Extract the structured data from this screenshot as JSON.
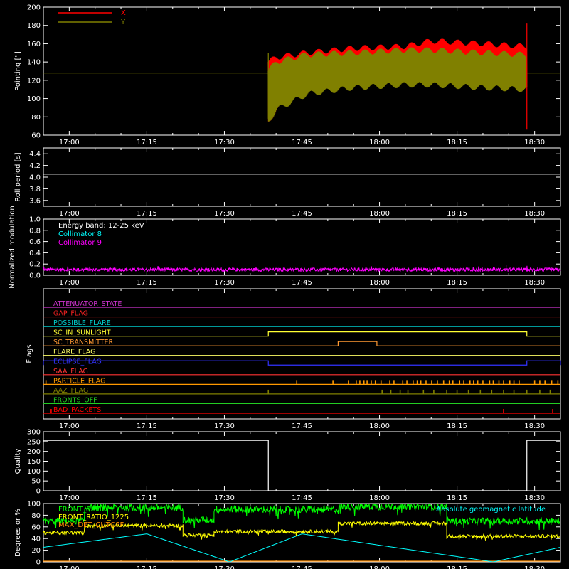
{
  "time_axis": {
    "range_minutes": [
      1015,
      1115
    ],
    "tick_minutes": [
      1020,
      1035,
      1050,
      1065,
      1080,
      1095,
      1110
    ],
    "tick_labels": [
      "17:00",
      "17:15",
      "17:30",
      "17:45",
      "18:00",
      "18:15",
      "18:30"
    ]
  },
  "chart_data": [
    {
      "id": "pointing",
      "type": "line",
      "ylabel": "Pointing [\"]",
      "ylim": [
        60,
        200
      ],
      "yticks": [
        60,
        80,
        100,
        120,
        140,
        160,
        180,
        200
      ],
      "grid": false,
      "legend_position": "top-left",
      "series": [
        {
          "name": "X",
          "color": "#ff0000",
          "baseline": 128,
          "active_range": [
            1058.5,
            1108.5
          ],
          "envelope": {
            "x": [
              1058.5,
              1060,
              1066,
              1075,
              1085,
              1090,
              1100,
              1108
            ],
            "upper": [
              140,
              145,
              150,
              155,
              157,
              163,
              160,
              157
            ],
            "lower": [
              75,
              88,
              108,
              116,
              117,
              117,
              115,
              114
            ]
          }
        },
        {
          "name": "Y",
          "color": "#808000",
          "baseline": 128,
          "active_range": [
            1058.5,
            1108.5
          ],
          "envelope": {
            "x": [
              1058.5,
              1060,
              1066,
              1075,
              1085,
              1090,
              1100,
              1108
            ],
            "upper": [
              130,
              140,
              148,
              150,
              153,
              153,
              150,
              148
            ],
            "lower": [
              75,
              88,
              105,
              112,
              115,
              115,
              112,
              110
            ]
          }
        }
      ]
    },
    {
      "id": "roll_period",
      "type": "line",
      "ylabel": "Roll period [s]",
      "ylim": [
        3.5,
        4.5
      ],
      "yticks": [
        3.6,
        3.8,
        4.0,
        4.2,
        4.4
      ],
      "ytick_labels": [
        "3.6",
        "3.8",
        "4.0",
        "4.2",
        "4.4"
      ],
      "series": [
        {
          "name": "",
          "color": "#ffffff",
          "value": 4.05
        }
      ]
    },
    {
      "id": "modulation",
      "type": "line",
      "ylabel": "Normalized modulation",
      "ylim": [
        0,
        1
      ],
      "yticks": [
        0,
        0.2,
        0.4,
        0.6,
        0.8,
        1.0
      ],
      "ytick_labels": [
        "0.0",
        "0.2",
        "0.4",
        "0.6",
        "0.8",
        "1.0"
      ],
      "annotations": [
        {
          "text": "Energy band: 12-25 keV",
          "color": "#ffffff"
        },
        {
          "text": "Collimator 8",
          "color": "#00ffff"
        },
        {
          "text": "Collimator 9",
          "color": "#ff00ff"
        }
      ],
      "series": [
        {
          "name": "Collimator 9",
          "color": "#ff00ff",
          "mean": 0.1,
          "noise": 0.03
        }
      ]
    },
    {
      "id": "flags",
      "type": "line",
      "ylabel": "Flags",
      "flags": [
        {
          "name": "ATTENUATOR_STATE",
          "color": "#cc33cc",
          "segments": []
        },
        {
          "name": "GAP_FLAG",
          "color": "#ff2222",
          "segments": []
        },
        {
          "name": "POSSIBLE_FLARE",
          "color": "#00cccc",
          "segments": []
        },
        {
          "name": "SC_IN_SUNLIGHT",
          "color": "#ffff33",
          "segments": [
            [
              1058.5,
              1108.5
            ]
          ]
        },
        {
          "name": "SC_TRANSMITTER",
          "color": "#ff9933",
          "segments": [
            [
              1072,
              1079.5
            ]
          ]
        },
        {
          "name": "FLARE_FLAG",
          "color": "#ffff66",
          "segments": []
        },
        {
          "name": "ECLIPSE_FLAG",
          "color": "#3333ff",
          "segments": [
            [
              1015,
              1058.5
            ],
            [
              1108.5,
              1115
            ]
          ]
        },
        {
          "name": "SAA_FLAG",
          "color": "#ff3333",
          "segments": []
        },
        {
          "name": "PARTICLE_FLAG",
          "color": "#ff9900",
          "spikes": [
            1015.5,
            1064,
            1071,
            1074,
            1075.5,
            1076.2,
            1077,
            1077.6,
            1078.4,
            1079.2,
            1080.3,
            1082,
            1082.8,
            1084.5,
            1085.3,
            1086.5,
            1087.3,
            1088,
            1089,
            1090.1,
            1091.2,
            1092.4,
            1093.5,
            1094.2,
            1095.5,
            1096.3,
            1097.5,
            1098.2,
            1099,
            1100,
            1101.3,
            1102,
            1103.1,
            1104,
            1105.2,
            1106,
            1107,
            1110,
            1111,
            1112,
            1113.3,
            1114.5
          ]
        },
        {
          "name": "AAZ_FLAG",
          "color": "#808000",
          "spikes": [
            1058.5,
            1080.5,
            1082.2,
            1084,
            1085.5,
            1088.5,
            1090.5,
            1093,
            1095,
            1097.2,
            1099.5,
            1101.7,
            1104,
            1106,
            1108.5,
            1111,
            1113
          ]
        },
        {
          "name": "FRONTS_OFF",
          "color": "#22cc22",
          "segments": []
        },
        {
          "name": "BAD_PACKETS",
          "color": "#ff0000",
          "spikes": [
            1016.5,
            1104,
            1113.5
          ]
        }
      ]
    },
    {
      "id": "quality",
      "type": "line",
      "ylabel": "Quality",
      "ylim": [
        0,
        300
      ],
      "yticks": [
        0,
        50,
        100,
        150,
        200,
        250,
        300
      ],
      "series": [
        {
          "name": "",
          "color": "#ffffff",
          "x": [
            1015,
            1058.5,
            1058.5,
            1108.5,
            1108.5,
            1115
          ],
          "y": [
            256,
            256,
            0,
            0,
            256,
            256
          ]
        }
      ]
    },
    {
      "id": "ratios",
      "type": "line",
      "ylabel": "Degrees or %",
      "ylim": [
        0,
        100
      ],
      "yticks": [
        0,
        20,
        40,
        60,
        80,
        100
      ],
      "series": [
        {
          "name": "FRONT_RATIO",
          "color": "#00ff00",
          "levels": [
            [
              1015,
              1023,
              70
            ],
            [
              1023,
              1042,
              93
            ],
            [
              1042,
              1048,
              72
            ],
            [
              1048,
              1072,
              90
            ],
            [
              1072,
              1093,
              95
            ],
            [
              1093,
              1115,
              70
            ]
          ]
        },
        {
          "name": "FRONT_RATIO_1225",
          "color": "#ffff00",
          "levels": [
            [
              1015,
              1023,
              50
            ],
            [
              1023,
              1042,
              62
            ],
            [
              1042,
              1048,
              46
            ],
            [
              1048,
              1072,
              52
            ],
            [
              1072,
              1093,
              66
            ],
            [
              1093,
              1115,
              44
            ]
          ]
        },
        {
          "name": "MAX_DET_CUTOFF",
          "color": "#ff8c00",
          "value": 0
        },
        {
          "name": "Absolute geomagnetic latitude",
          "color": "#00ffff",
          "x": [
            1015,
            1035,
            1051,
            1065,
            1102,
            1115
          ],
          "y": [
            25,
            48,
            0,
            48,
            0,
            25
          ]
        }
      ]
    }
  ]
}
